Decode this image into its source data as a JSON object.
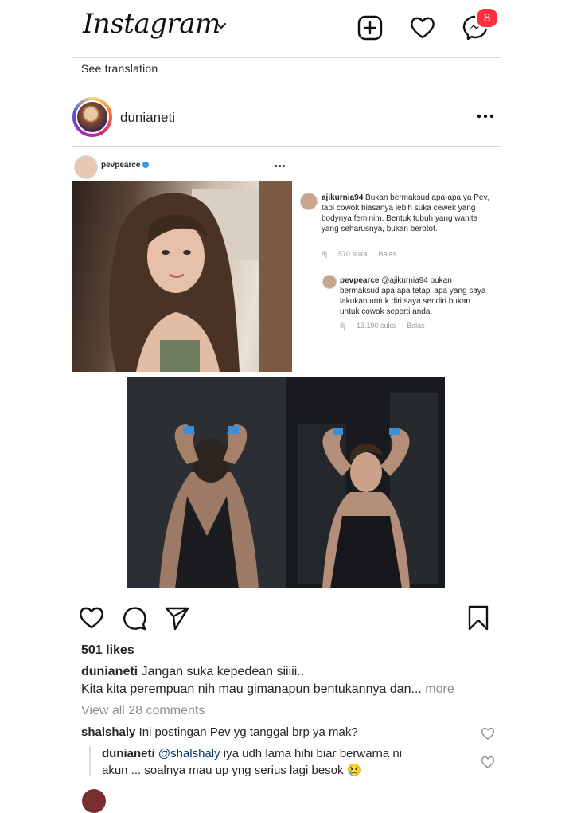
{
  "header": {
    "logo_text": "Instagram",
    "logo_dropdown_icon": "chevron-down-icon",
    "new_post_icon": "plus-square-icon",
    "activity_icon": "heart-icon",
    "messenger_icon": "messenger-icon",
    "messenger_badge": "8"
  },
  "translation": {
    "label": "See translation"
  },
  "post": {
    "username": "dunianeti",
    "more_icon": "more-horizontal-icon",
    "embedded": {
      "username": "pevpearce",
      "more_text": "•••",
      "comments": [
        {
          "user": "ajikurnia94",
          "text": " Bukan bermaksud apa-apa ya Pev, tapi cowok biasanya lebih suka cewek yang bodynya feminim. Bentuk tubuh yang wanita yang seharusnya, bukan berotot.",
          "time": "8j",
          "likes": "570 suka",
          "reply": "Balas"
        },
        {
          "user": "pevpearce",
          "text": " @ajikurnia94 bukan bermaksud apa apa tetapi apa yang saya lakukan untuk diri saya sendiri bukan untuk cowok seperti anda.",
          "time": "8j",
          "likes": "13.190 suka",
          "reply": "Balas"
        }
      ]
    },
    "actions": {
      "like_icon": "heart-icon",
      "comment_icon": "comment-icon",
      "share_icon": "send-icon",
      "save_icon": "bookmark-icon"
    },
    "likes": "501 likes",
    "caption": {
      "user": "dunianeti",
      "line1": " Jangan suka kepedean siiiii..",
      "line2": "Kita kita perempuan nih mau gimanapun bentukannya dan...",
      "more": "more"
    },
    "view_all": "View all 28 comments",
    "comments": [
      {
        "user": "shalshaly",
        "text": " Ini postingan Pev yg tanggal brp ya mak?"
      },
      {
        "user": "dunianeti",
        "mention": "@shalshaly",
        "text": " iya udh lama hihi biar berwarna ni",
        "text2": "akun ... soalnya mau up yng serius lagi besok 😢"
      }
    ]
  },
  "colors": {
    "badge": "#ff3040",
    "link": "#00376b",
    "muted": "#8e8e8e",
    "verified": "#3897f0"
  }
}
